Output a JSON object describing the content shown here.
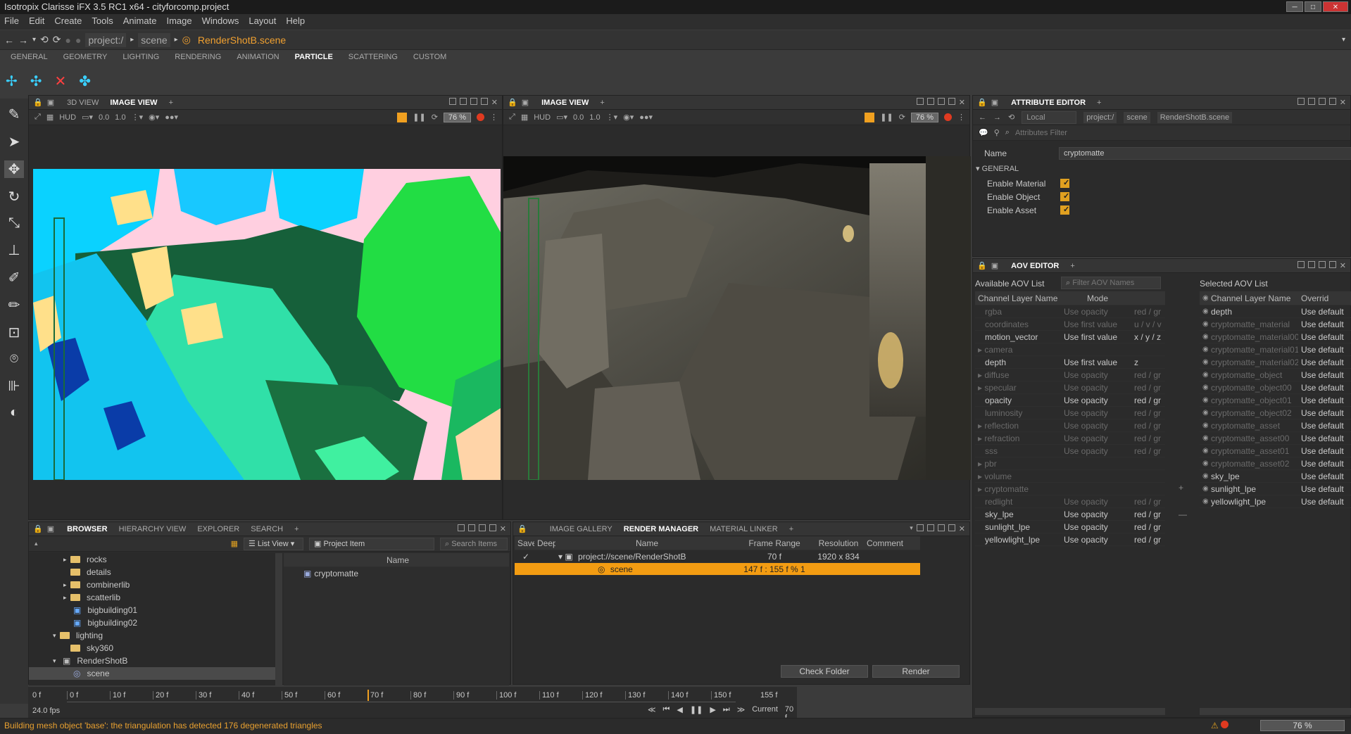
{
  "window": {
    "title": "Isotropix Clarisse iFX 3.5 RC1 x64 - cityforcomp.project"
  },
  "menu": [
    "File",
    "Edit",
    "Create",
    "Tools",
    "Animate",
    "Image",
    "Windows",
    "Layout",
    "Help"
  ],
  "path": {
    "project": "project:/",
    "scene": "scene",
    "current": "RenderShotB.scene"
  },
  "shelf_tabs": [
    "GENERAL",
    "GEOMETRY",
    "LIGHTING",
    "RENDERING",
    "ANIMATION",
    "PARTICLE",
    "SCATTERING",
    "CUSTOM"
  ],
  "shelf_active": "PARTICLE",
  "viewport1": {
    "tabs": [
      "3D VIEW",
      "IMAGE VIEW"
    ],
    "active": "IMAGE VIEW",
    "hud": "HUD",
    "exposure": "0.0",
    "gamma": "1.0",
    "zoom": "76 %"
  },
  "viewport2": {
    "tabs": [
      "IMAGE VIEW"
    ],
    "active": "IMAGE VIEW",
    "hud": "HUD",
    "exposure": "0.0",
    "gamma": "1.0",
    "zoom": "76 %"
  },
  "attr_editor": {
    "title": "ATTRIBUTE EDITOR",
    "context": "Local",
    "path_project": "project:/",
    "path_scene": "scene",
    "path_item": "RenderShotB.scene",
    "filter_placeholder": "Attributes Filter",
    "name_label": "Name",
    "name_value": "cryptomatte",
    "group": "GENERAL",
    "attrs": [
      {
        "label": "Enable Material"
      },
      {
        "label": "Enable Object"
      },
      {
        "label": "Enable Asset"
      }
    ]
  },
  "aov_editor": {
    "title": "AOV EDITOR",
    "available_label": "Available AOV List",
    "filter_placeholder": "Filter AOV Names",
    "selected_label": "Selected AOV List",
    "col_name": "Channel Layer Name",
    "col_mode": "Mode",
    "col_override": "Overrid",
    "available": [
      {
        "name": "rgba",
        "mode": "Use opacity",
        "ch": "red / gr",
        "dis": true,
        "exp": false
      },
      {
        "name": "coordinates",
        "mode": "Use first value",
        "ch": "u / v / v",
        "dis": true,
        "exp": false
      },
      {
        "name": "motion_vector",
        "mode": "Use first value",
        "ch": "x / y / z",
        "dis": false,
        "exp": false
      },
      {
        "name": "camera",
        "mode": "",
        "ch": "",
        "dis": true,
        "exp": true
      },
      {
        "name": "depth",
        "mode": "Use first value",
        "ch": "z",
        "dis": false,
        "exp": false
      },
      {
        "name": "diffuse",
        "mode": "Use opacity",
        "ch": "red / gr",
        "dis": true,
        "exp": true
      },
      {
        "name": "specular",
        "mode": "Use opacity",
        "ch": "red / gr",
        "dis": true,
        "exp": true
      },
      {
        "name": "opacity",
        "mode": "Use opacity",
        "ch": "red / gr",
        "dis": false,
        "exp": false
      },
      {
        "name": "luminosity",
        "mode": "Use opacity",
        "ch": "red / gr",
        "dis": true,
        "exp": false
      },
      {
        "name": "reflection",
        "mode": "Use opacity",
        "ch": "red / gr",
        "dis": true,
        "exp": true
      },
      {
        "name": "refraction",
        "mode": "Use opacity",
        "ch": "red / gr",
        "dis": true,
        "exp": true
      },
      {
        "name": "sss",
        "mode": "Use opacity",
        "ch": "red / gr",
        "dis": true,
        "exp": false
      },
      {
        "name": "pbr",
        "mode": "",
        "ch": "",
        "dis": true,
        "exp": true
      },
      {
        "name": "volume",
        "mode": "",
        "ch": "",
        "dis": true,
        "exp": true
      },
      {
        "name": "cryptomatte",
        "mode": "",
        "ch": "",
        "dis": true,
        "exp": true
      },
      {
        "name": "redlight",
        "mode": "Use opacity",
        "ch": "red / gr",
        "dis": true,
        "exp": false
      },
      {
        "name": "sky_lpe",
        "mode": "Use opacity",
        "ch": "red / gr",
        "dis": false,
        "exp": false
      },
      {
        "name": "sunlight_lpe",
        "mode": "Use opacity",
        "ch": "red / gr",
        "dis": false,
        "exp": false
      },
      {
        "name": "yellowlight_lpe",
        "mode": "Use opacity",
        "ch": "red / gr",
        "dis": false,
        "exp": false
      }
    ],
    "selected": [
      {
        "name": "depth",
        "ov": "Use default",
        "dis": false
      },
      {
        "name": "cryptomatte_material",
        "ov": "Use default",
        "dis": true
      },
      {
        "name": "cryptomatte_material00",
        "ov": "Use default",
        "dis": true
      },
      {
        "name": "cryptomatte_material01",
        "ov": "Use default",
        "dis": true
      },
      {
        "name": "cryptomatte_material02",
        "ov": "Use default",
        "dis": true
      },
      {
        "name": "cryptomatte_object",
        "ov": "Use default",
        "dis": true
      },
      {
        "name": "cryptomatte_object00",
        "ov": "Use default",
        "dis": true
      },
      {
        "name": "cryptomatte_object01",
        "ov": "Use default",
        "dis": true
      },
      {
        "name": "cryptomatte_object02",
        "ov": "Use default",
        "dis": true
      },
      {
        "name": "cryptomatte_asset",
        "ov": "Use default",
        "dis": true
      },
      {
        "name": "cryptomatte_asset00",
        "ov": "Use default",
        "dis": true
      },
      {
        "name": "cryptomatte_asset01",
        "ov": "Use default",
        "dis": true
      },
      {
        "name": "cryptomatte_asset02",
        "ov": "Use default",
        "dis": true
      },
      {
        "name": "sky_lpe",
        "ov": "Use default",
        "dis": false
      },
      {
        "name": "sunlight_lpe",
        "ov": "Use default",
        "dis": false
      },
      {
        "name": "yellowlight_lpe",
        "ov": "Use default",
        "dis": false
      }
    ]
  },
  "browser": {
    "tabs": [
      "BROWSER",
      "HIERARCHY VIEW",
      "EXPLORER",
      "SEARCH"
    ],
    "active": "BROWSER",
    "view_mode": "List View",
    "filter_type": "Project Item",
    "search_placeholder": "Search Items",
    "col_name": "Name",
    "tree": [
      {
        "label": "rocks",
        "indent": 3,
        "arrow": "▸",
        "type": "folder"
      },
      {
        "label": "details",
        "indent": 3,
        "arrow": "",
        "type": "folder"
      },
      {
        "label": "combinerlib",
        "indent": 3,
        "arrow": "▸",
        "type": "folder"
      },
      {
        "label": "scatterlib",
        "indent": 3,
        "arrow": "▸",
        "type": "folder"
      },
      {
        "label": "bigbuilding01",
        "indent": 3,
        "arrow": "",
        "type": "item"
      },
      {
        "label": "bigbuilding02",
        "indent": 3,
        "arrow": "",
        "type": "item"
      },
      {
        "label": "lighting",
        "indent": 2,
        "arrow": "▾",
        "type": "folder"
      },
      {
        "label": "sky360",
        "indent": 3,
        "arrow": "",
        "type": "folder"
      },
      {
        "label": "RenderShotB",
        "indent": 2,
        "arrow": "▾",
        "type": "image"
      },
      {
        "label": "scene",
        "indent": 3,
        "arrow": "",
        "type": "scene"
      }
    ],
    "items": [
      {
        "label": "cryptomatte"
      }
    ]
  },
  "render_manager": {
    "tabs": [
      "IMAGE GALLERY",
      "RENDER MANAGER",
      "MATERIAL LINKER"
    ],
    "active": "RENDER MANAGER",
    "cols": {
      "save": "Save",
      "deep": "Deep",
      "name": "Name",
      "frames": "Frame Range",
      "res": "Resolution",
      "comment": "Comment"
    },
    "rows": [
      {
        "name": "project://scene/RenderShotB",
        "frames": "70 f",
        "res": "1920 x 834",
        "selected": false
      },
      {
        "name": "scene",
        "frames": "147 f : 155 f % 1",
        "res": "",
        "selected": true
      }
    ],
    "check_folder": "Check Folder",
    "render": "Render"
  },
  "timeline": {
    "ticks": [
      "0 f",
      "10 f",
      "20 f",
      "30 f",
      "40 f",
      "50 f",
      "60 f",
      "70 f",
      "80 f",
      "90 f",
      "100 f",
      "110 f",
      "120 f",
      "130 f",
      "140 f",
      "150 f"
    ],
    "start": "0 f",
    "end": "155 f",
    "fps": "24.0 fps",
    "current_label": "Current",
    "current": "70 f",
    "current_frame": 70,
    "range_min": 0,
    "range_max": 155
  },
  "status": {
    "message": "Building mesh object 'base': the triangulation has detected 176 degenerated triangles",
    "zoom": "76 %"
  },
  "colors": {
    "accent": "#f0a020",
    "selection": "#f39c12"
  }
}
